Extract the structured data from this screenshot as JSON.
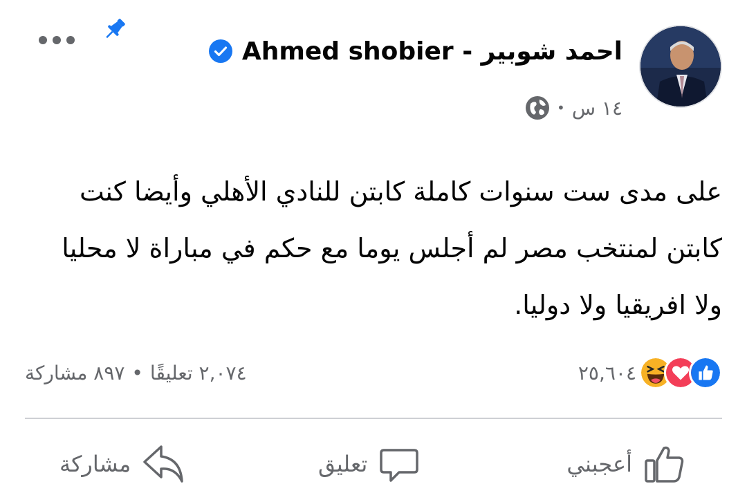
{
  "post": {
    "author": "Ahmed shobier - احمد شوبير",
    "time": "١٤ س",
    "separator": "•",
    "text": "على مدى ست سنوات كاملة كابتن للنادي الأهلي وأيضا كنت كابتن لمنتخب مصر لم أجلس يوما مع حكم في مباراة لا محليا ولا افريقيا ولا دوليا."
  },
  "reactions": {
    "count": "٢٥,٦٠٤",
    "types": [
      "like",
      "love",
      "haha"
    ]
  },
  "stats": {
    "comments": "٢,٠٧٤ تعليقًا",
    "separator": "•",
    "shares": "٨٩٧ مشاركة"
  },
  "actions": {
    "like_label": "أعجبني",
    "comment_label": "تعليق",
    "share_label": "مشاركة"
  },
  "colors": {
    "accent": "#1877f2",
    "love": "#f33e58",
    "haha": "#f7b125",
    "secondary_text": "#65676b"
  },
  "icons": {
    "verified": "verified-badge-icon",
    "globe": "globe-icon",
    "pin": "pin-icon",
    "more": "more-options-icon"
  }
}
